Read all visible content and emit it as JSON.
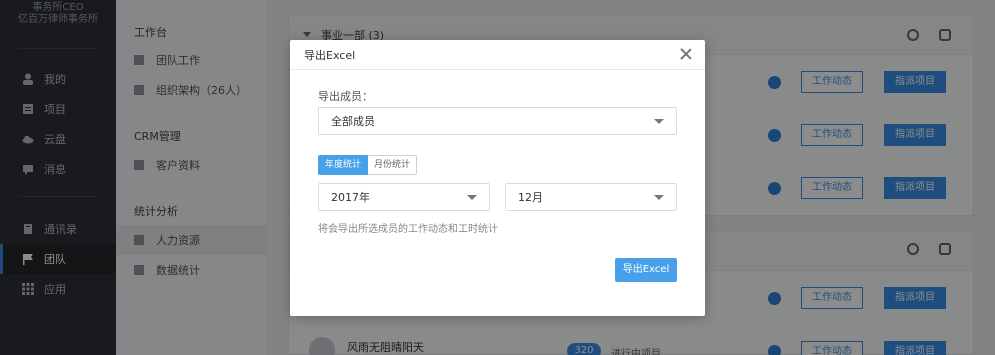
{
  "leftnav": {
    "org_name_line1": "事务所CEO",
    "org_name_line2": "亿百万律师事务所",
    "items": [
      {
        "label": "我的",
        "icon": "user-icon"
      },
      {
        "label": "项目",
        "icon": "project-icon"
      },
      {
        "label": "云盘",
        "icon": "cloud-icon"
      },
      {
        "label": "消息",
        "icon": "message-icon"
      },
      {
        "label": "通讯录",
        "icon": "contacts-icon"
      },
      {
        "label": "团队",
        "icon": "flag-icon"
      },
      {
        "label": "应用",
        "icon": "apps-grid-icon"
      }
    ],
    "active": "团队"
  },
  "subnav": {
    "sections": [
      {
        "title": "工作台",
        "items": [
          "团队工作",
          "组织架构（26人）"
        ]
      },
      {
        "title": "CRM管理",
        "items": [
          "客户资料"
        ]
      },
      {
        "title": "统计分析",
        "items": [
          "人力资源",
          "数据统计"
        ]
      }
    ],
    "active": "人力资源"
  },
  "main": {
    "group1_title": "事业一部 (3)",
    "btn_work_status": "工作动态",
    "btn_assign": "指派项目",
    "member_name": "风雨无阻晴阳天",
    "member_count": "320",
    "member_status": "进行中项目"
  },
  "modal": {
    "title": "导出Excel",
    "members_label": "导出成员：",
    "members_value": "全部成员",
    "tab_year": "年度统计",
    "tab_month": "月份统计",
    "year_value": "2017年",
    "month_value": "12月",
    "hint": "将会导出所选成员的工作动态和工时统计",
    "export_button": "导出Excel"
  },
  "colors": {
    "accent": "#3a8ee6",
    "nav_bg": "#2f3136"
  }
}
